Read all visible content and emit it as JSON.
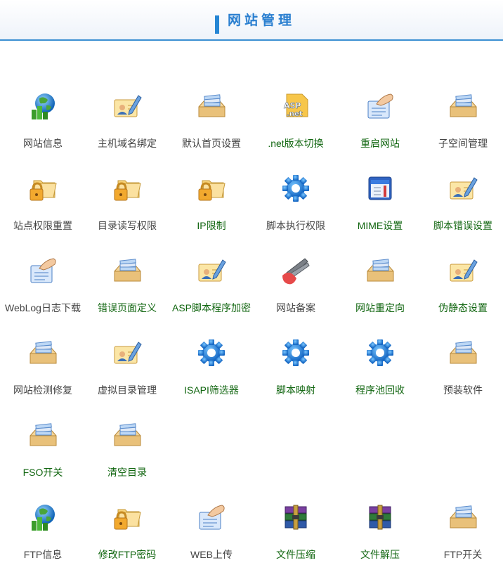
{
  "header": {
    "title": "网站管理"
  },
  "rows": [
    [
      {
        "label": "网站信息",
        "icon": "globe-chart-icon",
        "style": "gray"
      },
      {
        "label": "主机域名绑定",
        "icon": "edit-card-icon",
        "style": "gray"
      },
      {
        "label": "默认首页设置",
        "icon": "drawer-icon",
        "style": "gray"
      },
      {
        "label": ".net版本切换",
        "icon": "asp-net-icon",
        "style": "green"
      },
      {
        "label": "重启网站",
        "icon": "hand-card-icon",
        "style": "green"
      },
      {
        "label": "子空间管理",
        "icon": "drawer-icon",
        "style": "gray"
      }
    ],
    [
      {
        "label": "站点权限重置",
        "icon": "lock-folder-icon",
        "style": "gray"
      },
      {
        "label": "目录读写权限",
        "icon": "lock-folder-icon",
        "style": "gray"
      },
      {
        "label": "IP限制",
        "icon": "lock-folder-icon",
        "style": "green"
      },
      {
        "label": "脚本执行权限",
        "icon": "gear-icon",
        "style": "gray"
      },
      {
        "label": "MIME设置",
        "icon": "book-icon",
        "style": "green"
      },
      {
        "label": "脚本错误设置",
        "icon": "edit-card-icon",
        "style": "green"
      }
    ],
    [
      {
        "label": "WebLog日志下载",
        "icon": "hand-card-icon",
        "style": "gray"
      },
      {
        "label": "错误页面定义",
        "icon": "drawer-icon",
        "style": "green"
      },
      {
        "label": "ASP脚本程序加密",
        "icon": "edit-card-icon",
        "style": "green"
      },
      {
        "label": "网站备案",
        "icon": "fan-icon",
        "style": "gray"
      },
      {
        "label": "网站重定向",
        "icon": "drawer-icon",
        "style": "green"
      },
      {
        "label": "伪静态设置",
        "icon": "edit-card-icon",
        "style": "green"
      }
    ],
    [
      {
        "label": "网站检测修复",
        "icon": "drawer-icon",
        "style": "gray"
      },
      {
        "label": "虚拟目录管理",
        "icon": "edit-card-icon",
        "style": "gray"
      },
      {
        "label": "ISAPI筛选器",
        "icon": "gear-icon",
        "style": "green"
      },
      {
        "label": "脚本映射",
        "icon": "gear-icon",
        "style": "green"
      },
      {
        "label": "程序池回收",
        "icon": "gear-icon",
        "style": "green"
      },
      {
        "label": "预装软件",
        "icon": "drawer-icon",
        "style": "gray"
      }
    ],
    [
      {
        "label": "FSO开关",
        "icon": "drawer-icon",
        "style": "green"
      },
      {
        "label": "清空目录",
        "icon": "drawer-icon",
        "style": "green"
      }
    ],
    [
      {
        "label": "FTP信息",
        "icon": "globe-chart-icon",
        "style": "gray"
      },
      {
        "label": "修改FTP密码",
        "icon": "lock-folder-icon",
        "style": "green"
      },
      {
        "label": "WEB上传",
        "icon": "hand-card-icon",
        "style": "gray"
      },
      {
        "label": "文件压缩",
        "icon": "archive-icon",
        "style": "green"
      },
      {
        "label": "文件解压",
        "icon": "archive-icon",
        "style": "green"
      },
      {
        "label": "FTP开关",
        "icon": "drawer-icon",
        "style": "gray"
      }
    ]
  ]
}
